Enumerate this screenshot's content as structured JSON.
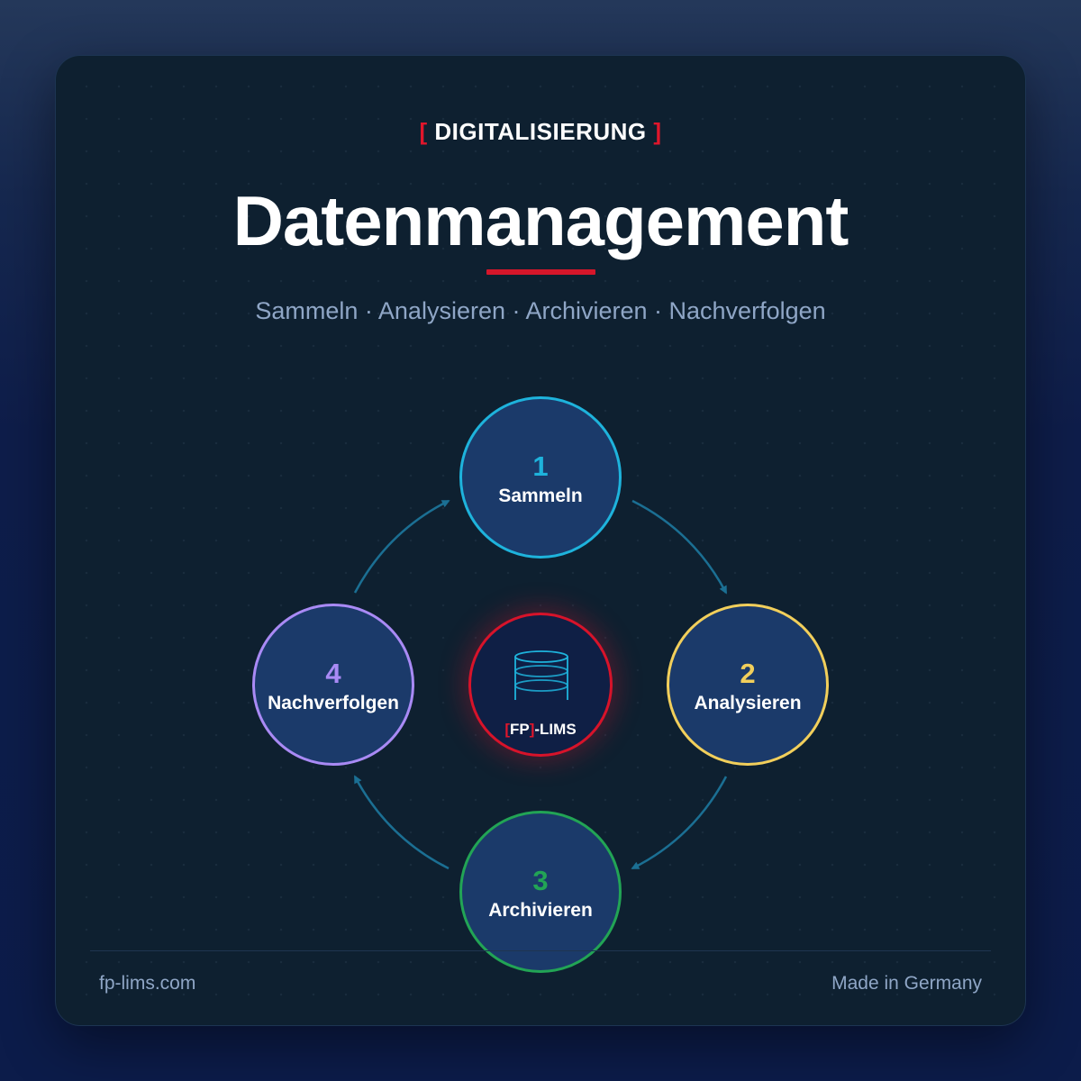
{
  "header": {
    "eyebrow_open": "[",
    "eyebrow_text": "DIGITALISIERUNG",
    "eyebrow_close": "]",
    "title": "Datenmanagement",
    "subtitle": "Sammeln · Analysieren · Archivieren · Nachverfolgen"
  },
  "cycle": {
    "steps": [
      {
        "number": "1",
        "label": "Sammeln",
        "color": "#1eb3dc"
      },
      {
        "number": "2",
        "label": "Analysieren",
        "color": "#f2cf5b"
      },
      {
        "number": "3",
        "label": "Archivieren",
        "color": "#22a455"
      },
      {
        "number": "4",
        "label": "Nachverfolgen",
        "color": "#a98af5"
      }
    ],
    "arrow_color": "#1b6f93",
    "center": {
      "icon": "database-icon",
      "brand_open": "[",
      "brand_name": "FP",
      "brand_close": "]",
      "brand_suffix": "-LIMS",
      "color": "#d7132a"
    }
  },
  "footer": {
    "website": "fp-lims.com",
    "made_in": "Made in Germany"
  },
  "colors": {
    "accent_red": "#d5162a",
    "card_bg": "#0e2030",
    "node_fill": "#1b3a6a",
    "muted_text": "#8fa6c6"
  }
}
